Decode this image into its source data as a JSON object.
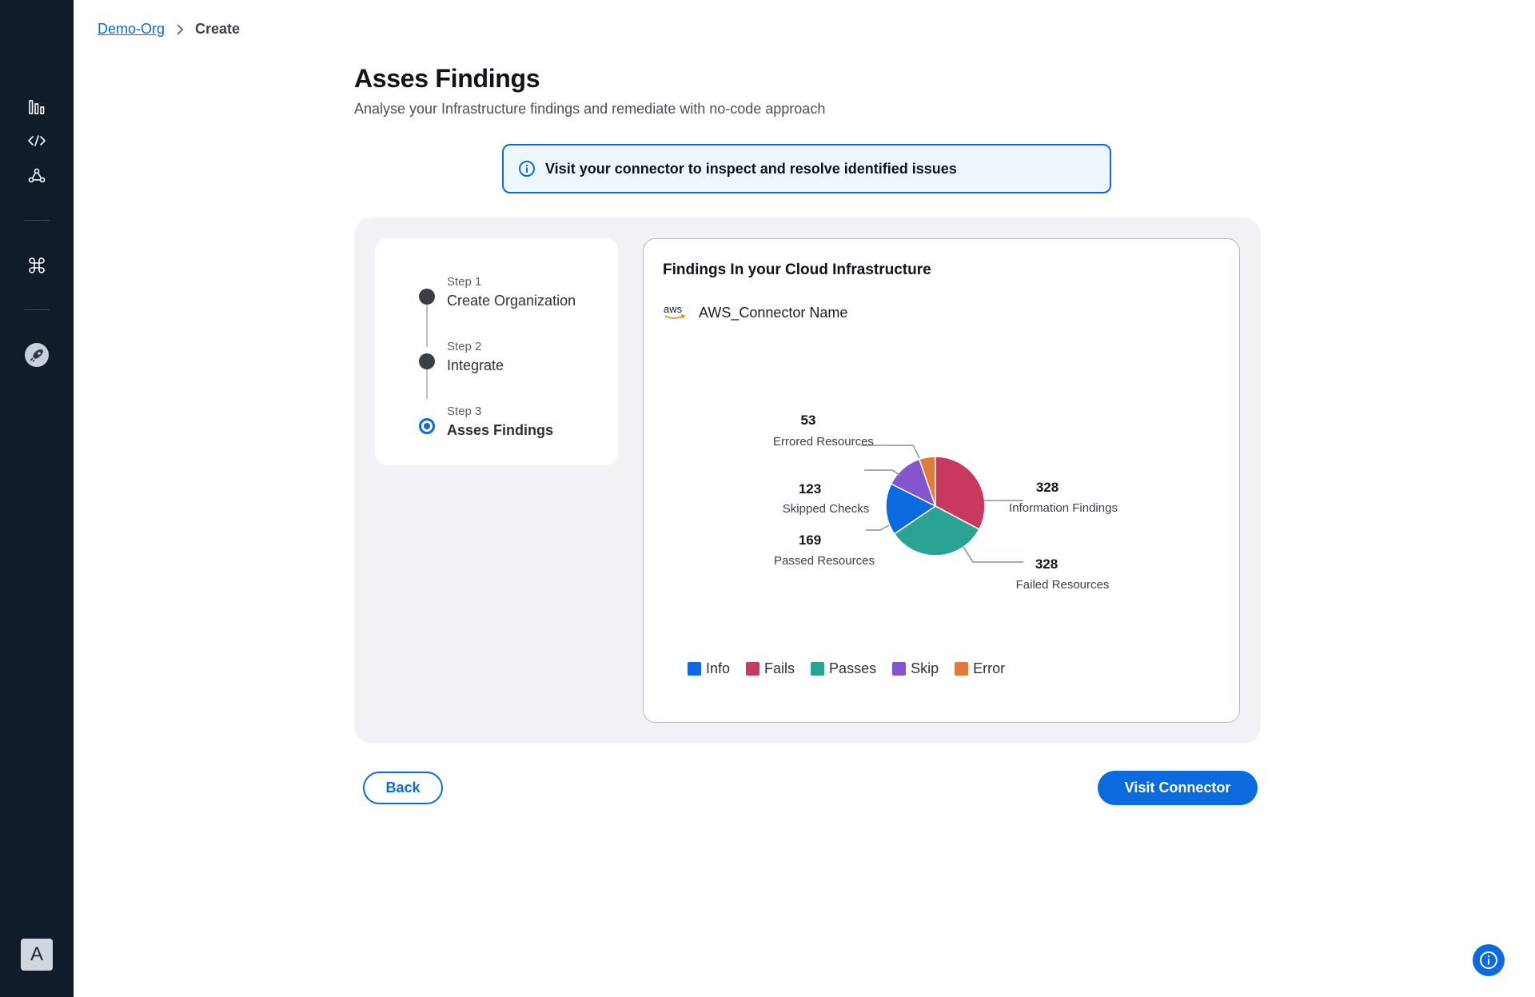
{
  "sidebar": {
    "icons": [
      "bar-chart-icon",
      "code-icon",
      "nodes-icon",
      "command-icon",
      "rocket-icon"
    ],
    "avatar_initial": "A"
  },
  "breadcrumb": {
    "parent": "Demo-Org",
    "current": "Create"
  },
  "page": {
    "title": "Asses Findings",
    "subtitle": "Analyse your Infrastructure findings and remediate with no-code approach"
  },
  "alert": {
    "text": "Visit your connector to inspect and resolve identified issues",
    "icon": "info-icon"
  },
  "steps": [
    {
      "label": "Step 1",
      "name": "Create Organization",
      "state": "done"
    },
    {
      "label": "Step 2",
      "name": "Integrate",
      "state": "done"
    },
    {
      "label": "Step 3",
      "name": "Asses Findings",
      "state": "active"
    }
  ],
  "card": {
    "title": "Findings In your Cloud Infrastructure",
    "connector_logo_text": "aws",
    "connector_name": "AWS_Connector Name"
  },
  "chart_data": {
    "type": "pie",
    "slices": [
      {
        "key": "error",
        "legend": "Error",
        "label": "Errored Resources",
        "value": 53,
        "color": "#e07b39"
      },
      {
        "key": "fails",
        "legend": "Fails",
        "label": "Information Findings",
        "value": 328,
        "color": "#c9395f"
      },
      {
        "key": "passes",
        "legend": "Passes",
        "label": "Failed Resources",
        "value": 328,
        "color": "#2ba393"
      },
      {
        "key": "info",
        "legend": "Info",
        "label": "Passed Resources",
        "value": 169,
        "color": "#0b6bde"
      },
      {
        "key": "skip",
        "legend": "Skip",
        "label": "Skipped Checks",
        "value": 123,
        "color": "#8455d1"
      }
    ],
    "legend": [
      {
        "name": "Info",
        "color": "#0b6bde"
      },
      {
        "name": "Fails",
        "color": "#c9395f"
      },
      {
        "name": "Passes",
        "color": "#2ba393"
      },
      {
        "name": "Skip",
        "color": "#8455d1"
      },
      {
        "name": "Error",
        "color": "#e07b39"
      }
    ],
    "legend_position": "bottom-left"
  },
  "actions": {
    "back": "Back",
    "visit": "Visit Connector"
  },
  "colors": {
    "accent": "#0b6bde",
    "sidebar_bg": "#111c2b"
  }
}
